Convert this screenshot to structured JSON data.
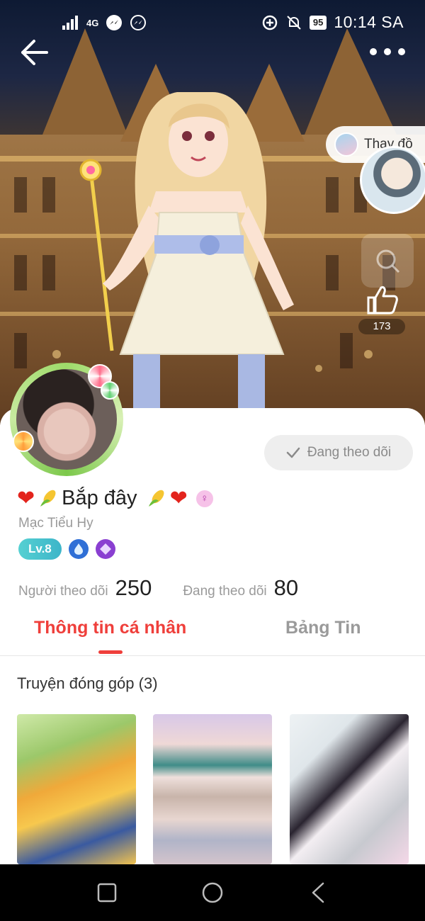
{
  "status_bar": {
    "network": "4G",
    "battery": "95",
    "time": "10:14 SA"
  },
  "hero": {
    "change_outfit_label": "Thay đồ",
    "like_count": "173"
  },
  "profile": {
    "follow_button_label": "Đang theo dõi",
    "display_name": "Bắp đây",
    "username": "Mạc Tiểu Hy",
    "level_badge": "Lv.8",
    "followers_label": "Người theo dõi",
    "followers_count": "250",
    "following_label": "Đang theo dõi",
    "following_count": "80"
  },
  "tabs": [
    {
      "label": "Thông tin cá nhân",
      "active": true
    },
    {
      "label": "Bảng Tin",
      "active": false
    }
  ],
  "contributions": {
    "title": "Truyện đóng góp (3)"
  },
  "colors": {
    "accent": "#ef3f3b",
    "level_badge": "#3db5c9"
  }
}
